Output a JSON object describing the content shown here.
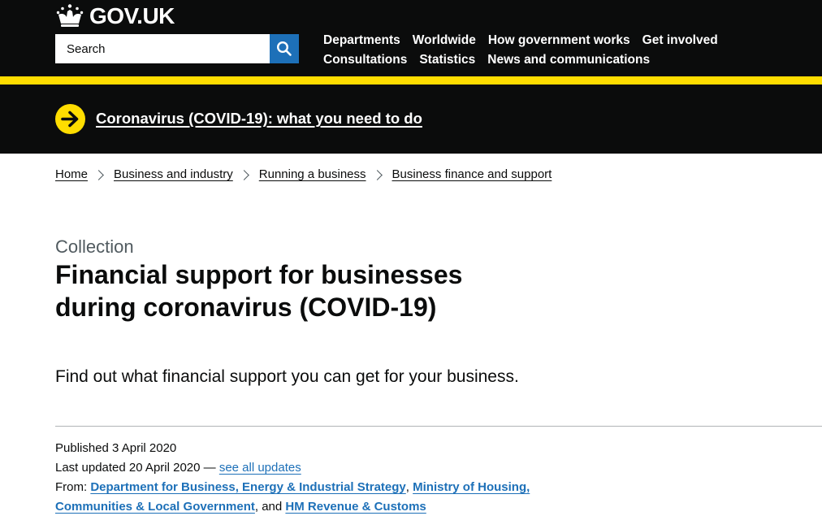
{
  "header": {
    "logo_text": "GOV.UK",
    "search": {
      "placeholder": "Search"
    },
    "nav_row1": [
      "Departments",
      "Worldwide",
      "How government works",
      "Get involved"
    ],
    "nav_row2": [
      "Consultations",
      "Statistics",
      "News and communications"
    ]
  },
  "banner": {
    "link_text": "Coronavirus (COVID-19): what you need to do",
    "accent_color": "#ffdd00"
  },
  "breadcrumbs": [
    "Home",
    "Business and industry",
    "Running a business",
    "Business finance and support"
  ],
  "page": {
    "caption": "Collection",
    "title": "Financial support for businesses during coronavirus (COVID-19)",
    "lead": "Find out what financial support you can get for your business."
  },
  "meta": {
    "published": "Published 3 April 2020",
    "last_updated": "Last updated 20 April 2020 — ",
    "see_updates": "see all updates",
    "from_label": "From: ",
    "orgs": [
      "Department for Business, Energy & Industrial Strategy",
      "Ministry of Housing, Communities & Local Government",
      "HM Revenue & Customs"
    ],
    "sep_comma": ", ",
    "sep_and": ", and "
  },
  "colors": {
    "header_bg": "#0b0c0c",
    "link_blue": "#1d70b8",
    "search_button": "#1d70b8",
    "caption_grey": "#505a5f"
  },
  "icons": {
    "logo": "crown-icon",
    "search": "search-icon",
    "banner": "arrow-right-circle-icon",
    "breadcrumb_separator": "chevron-right-icon"
  }
}
